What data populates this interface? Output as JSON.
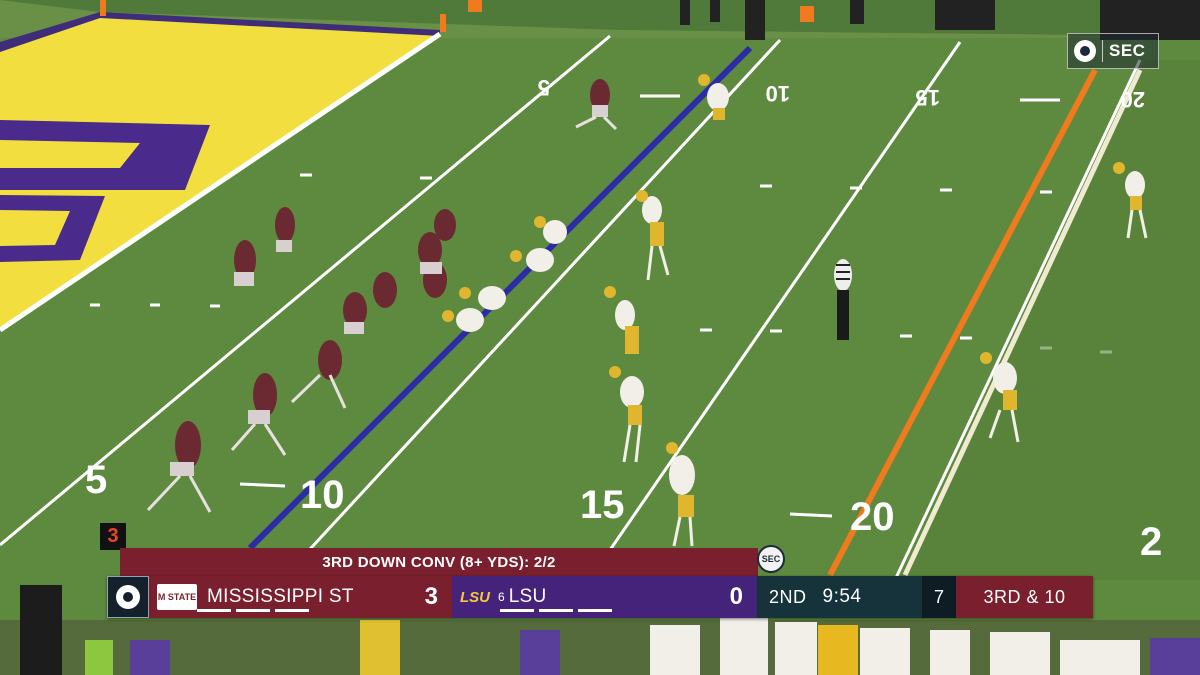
{
  "network": {
    "name": "SEC",
    "logo": "cbs-eye-icon"
  },
  "field": {
    "yard_numbers": [
      "5",
      "10",
      "15",
      "20",
      "2"
    ],
    "endzone_color": "#f4e042",
    "endzone_text_color": "#4a2a8a",
    "turf_color": "#5f8a3e",
    "line_of_scrimmage_color": "#2a2aa8",
    "first_down_line_color": "#f07a1e"
  },
  "scorebug": {
    "stat_banner": "3RD DOWN CONV (8+ YDS):  2/2",
    "down_tab": "3",
    "conference_badge": "SEC",
    "away": {
      "name": "MISSISSIPPI ST",
      "logo": "M STATE",
      "score": "3",
      "color": "#7a1f2e"
    },
    "home": {
      "name": "LSU",
      "rank": "6",
      "logo": "LSU",
      "score": "0",
      "color": "#46237a"
    },
    "period": "2ND",
    "clock": "9:54",
    "play_clock": "7",
    "down_distance": "3RD & 10"
  }
}
